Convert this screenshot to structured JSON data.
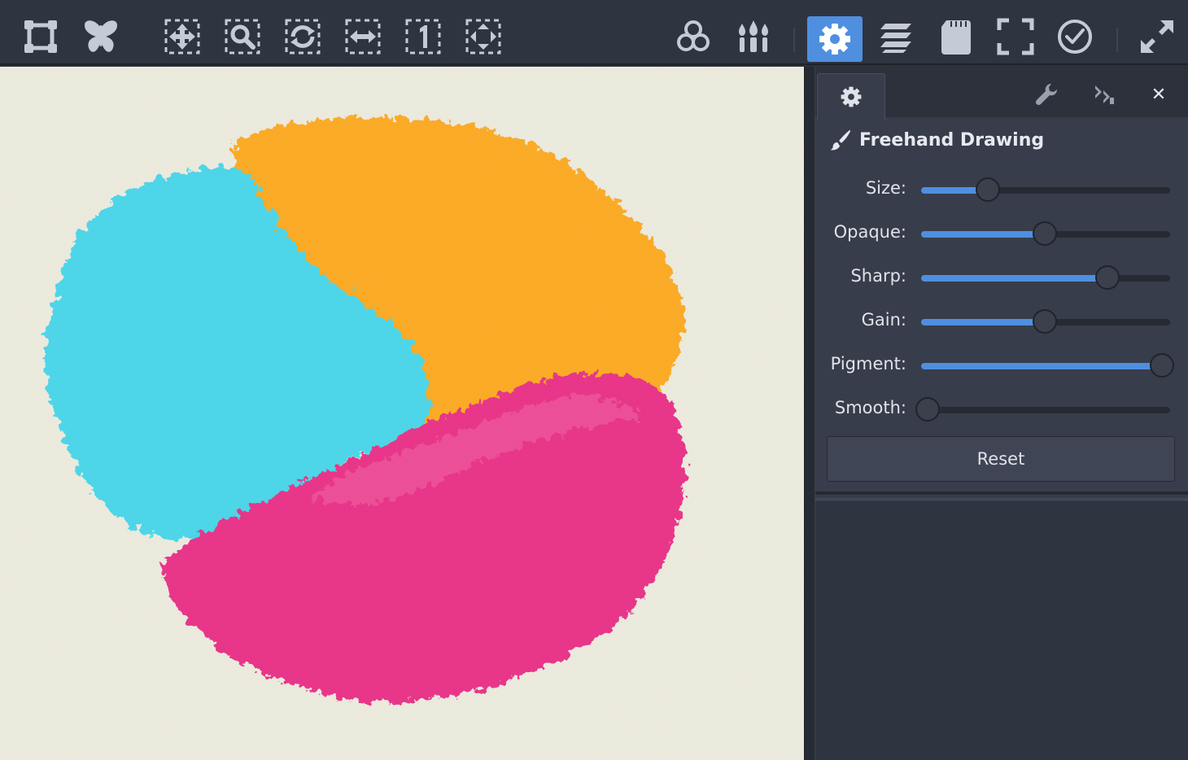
{
  "toolbar": {
    "left_tools": [
      {
        "name": "frame-icon"
      },
      {
        "name": "butterfly-icon"
      },
      {
        "name": "move-icon"
      },
      {
        "name": "zoom-icon"
      },
      {
        "name": "rotate-icon"
      },
      {
        "name": "flip-horizontal-icon"
      },
      {
        "name": "actual-size-icon"
      },
      {
        "name": "fit-screen-icon"
      }
    ],
    "right_tools": [
      {
        "name": "color-mixer-icon"
      },
      {
        "name": "brushes-icon"
      },
      {
        "name": "settings-icon",
        "active": true
      },
      {
        "name": "layers-icon"
      },
      {
        "name": "sd-card-icon"
      },
      {
        "name": "fullscreen-icon"
      },
      {
        "name": "clock-icon"
      },
      {
        "name": "expand-icon"
      }
    ],
    "accent_color": "#4f8fe0"
  },
  "panel": {
    "tab_icon": "settings-icon",
    "tool_icons": [
      "wrench-icon",
      "collapse-icon",
      "close-icon"
    ],
    "close_glyph": "✕",
    "tool_name": "Freehand Drawing",
    "tool_icon": "brush-icon",
    "sliders": [
      {
        "label": "Size:",
        "value": 0.27
      },
      {
        "label": "Opaque:",
        "value": 0.5
      },
      {
        "label": "Sharp:",
        "value": 0.75
      },
      {
        "label": "Gain:",
        "value": 0.5
      },
      {
        "label": "Pigment:",
        "value": 0.97
      },
      {
        "label": "Smooth:",
        "value": 0.03
      }
    ],
    "reset_label": "Reset"
  },
  "canvas": {
    "background_color": "#edecdf",
    "paint_colors": {
      "cyan": "#3fd6ec",
      "orange": "#ffa717",
      "magenta": "#ea2783"
    }
  }
}
